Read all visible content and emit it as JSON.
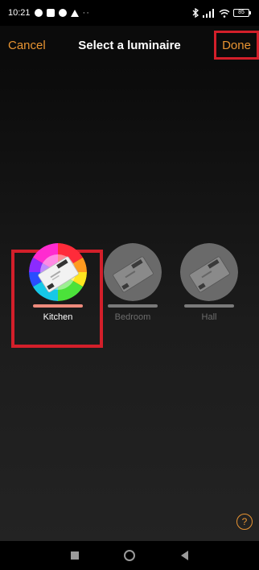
{
  "status_bar": {
    "time": "10:21",
    "battery": "85"
  },
  "header": {
    "cancel_label": "Cancel",
    "title": "Select a luminaire",
    "done_label": "Done"
  },
  "luminaires": [
    {
      "name": "Kitchen",
      "selected": true
    },
    {
      "name": "Bedroom",
      "selected": false
    },
    {
      "name": "Hall",
      "selected": false
    }
  ],
  "help_icon": "?",
  "colors": {
    "accent": "#e89432",
    "selected_bar": "#ee8a7c",
    "highlight": "#d31f2a"
  },
  "icons": [
    "controller-device-icon",
    "help-icon",
    "recent-apps-icon",
    "home-icon",
    "back-icon"
  ]
}
